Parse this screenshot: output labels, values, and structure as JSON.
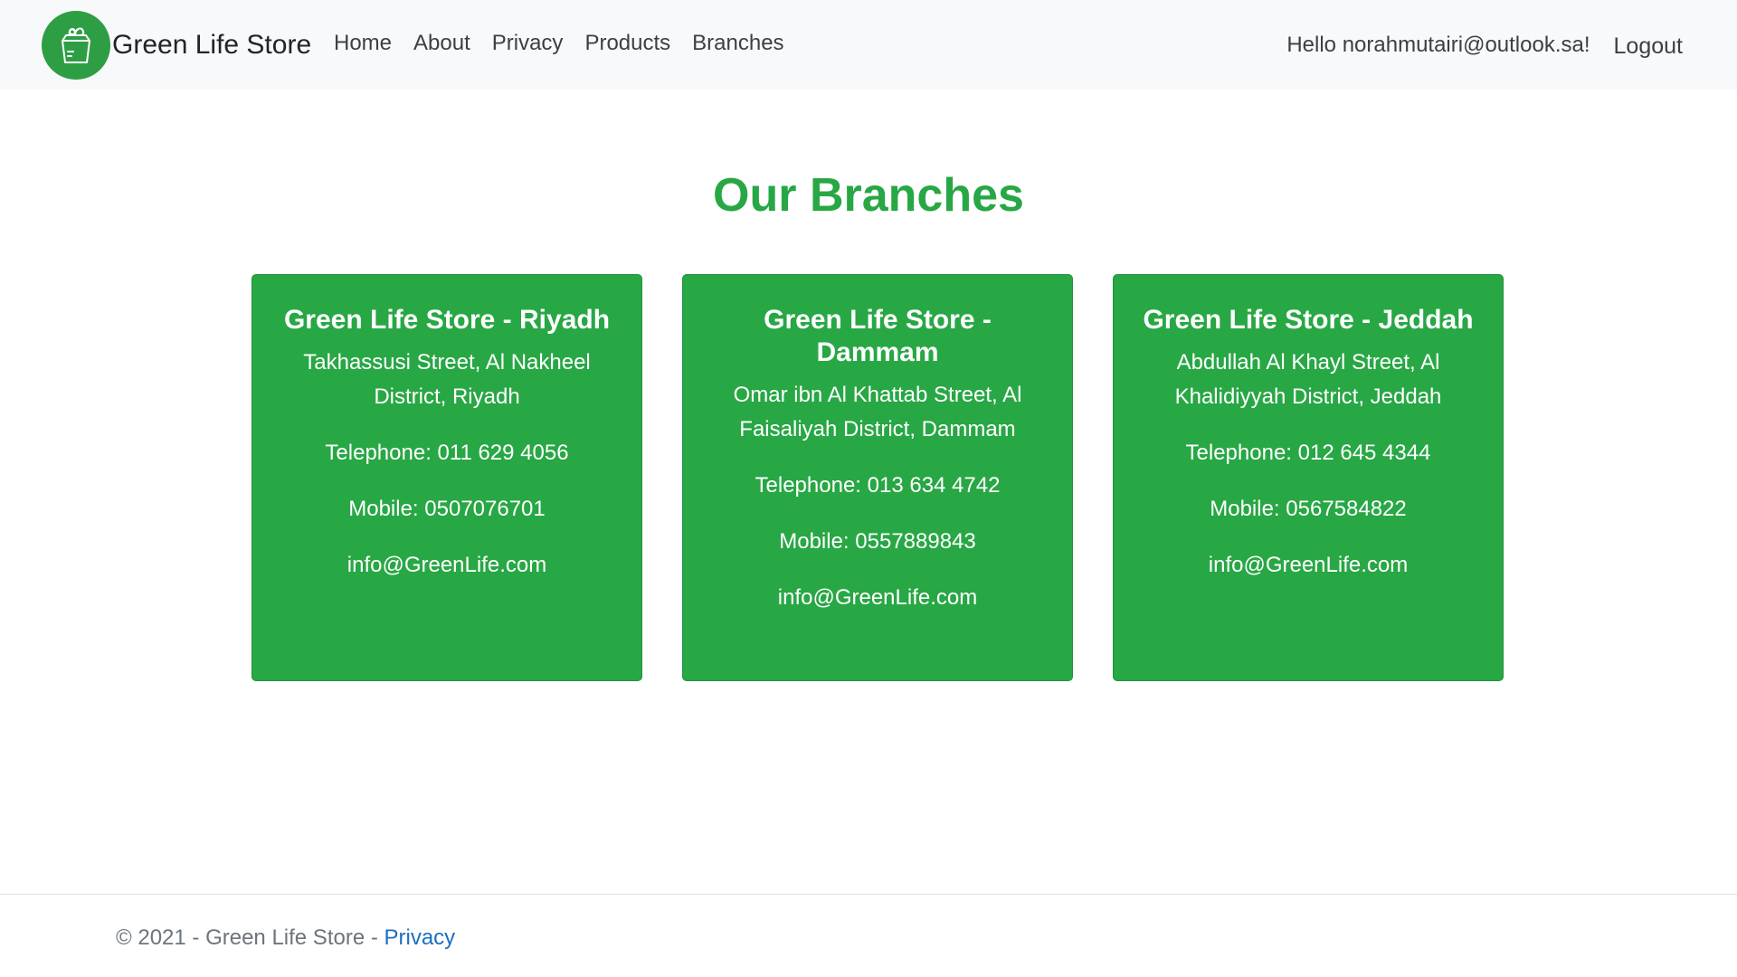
{
  "navbar": {
    "brand": "Green Life Store",
    "links": [
      "Home",
      "About",
      "Privacy",
      "Products",
      "Branches"
    ],
    "greeting": "Hello norahmutairi@outlook.sa!",
    "logout": "Logout"
  },
  "main": {
    "title": "Our Branches",
    "branches": [
      {
        "name": "Green Life Store - Riyadh",
        "address": "Takhassusi Street, Al Nakheel District, Riyadh",
        "telephone": "Telephone: 011 629 4056",
        "mobile": "Mobile: 0507076701",
        "email": "info@GreenLife.com"
      },
      {
        "name": "Green Life Store - Dammam",
        "address": "Omar ibn Al Khattab Street, Al Faisaliyah District, Dammam",
        "telephone": "Telephone: 013 634 4742",
        "mobile": "Mobile: 0557889843",
        "email": "info@GreenLife.com"
      },
      {
        "name": "Green Life Store - Jeddah",
        "address": "Abdullah Al Khayl Street, Al Khalidiyyah District, Jeddah",
        "telephone": "Telephone: 012 645 4344",
        "mobile": "Mobile: 0567584822",
        "email": "info@GreenLife.com"
      }
    ]
  },
  "footer": {
    "copyright": "© 2021 - Green Life Store - ",
    "privacy_link": "Privacy"
  },
  "colors": {
    "accent": "#28a745",
    "navbar_bg": "#f8f9fa",
    "link": "#1b6ec2"
  },
  "icons": {
    "logo": "grocery-bag-icon"
  }
}
